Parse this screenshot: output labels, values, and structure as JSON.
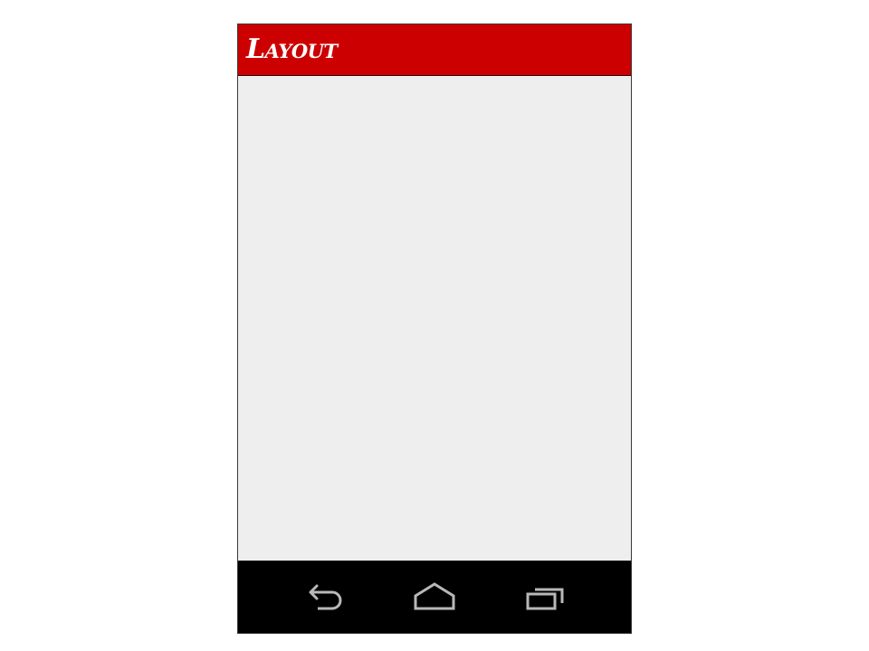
{
  "action_bar": {
    "title": "Layout",
    "color": "#cc0000"
  },
  "content": {
    "background": "#eeeeee"
  },
  "navigation_bar": {
    "background": "#000000",
    "buttons": [
      {
        "icon": "back-icon"
      },
      {
        "icon": "home-icon"
      },
      {
        "icon": "recent-apps-icon"
      }
    ]
  }
}
